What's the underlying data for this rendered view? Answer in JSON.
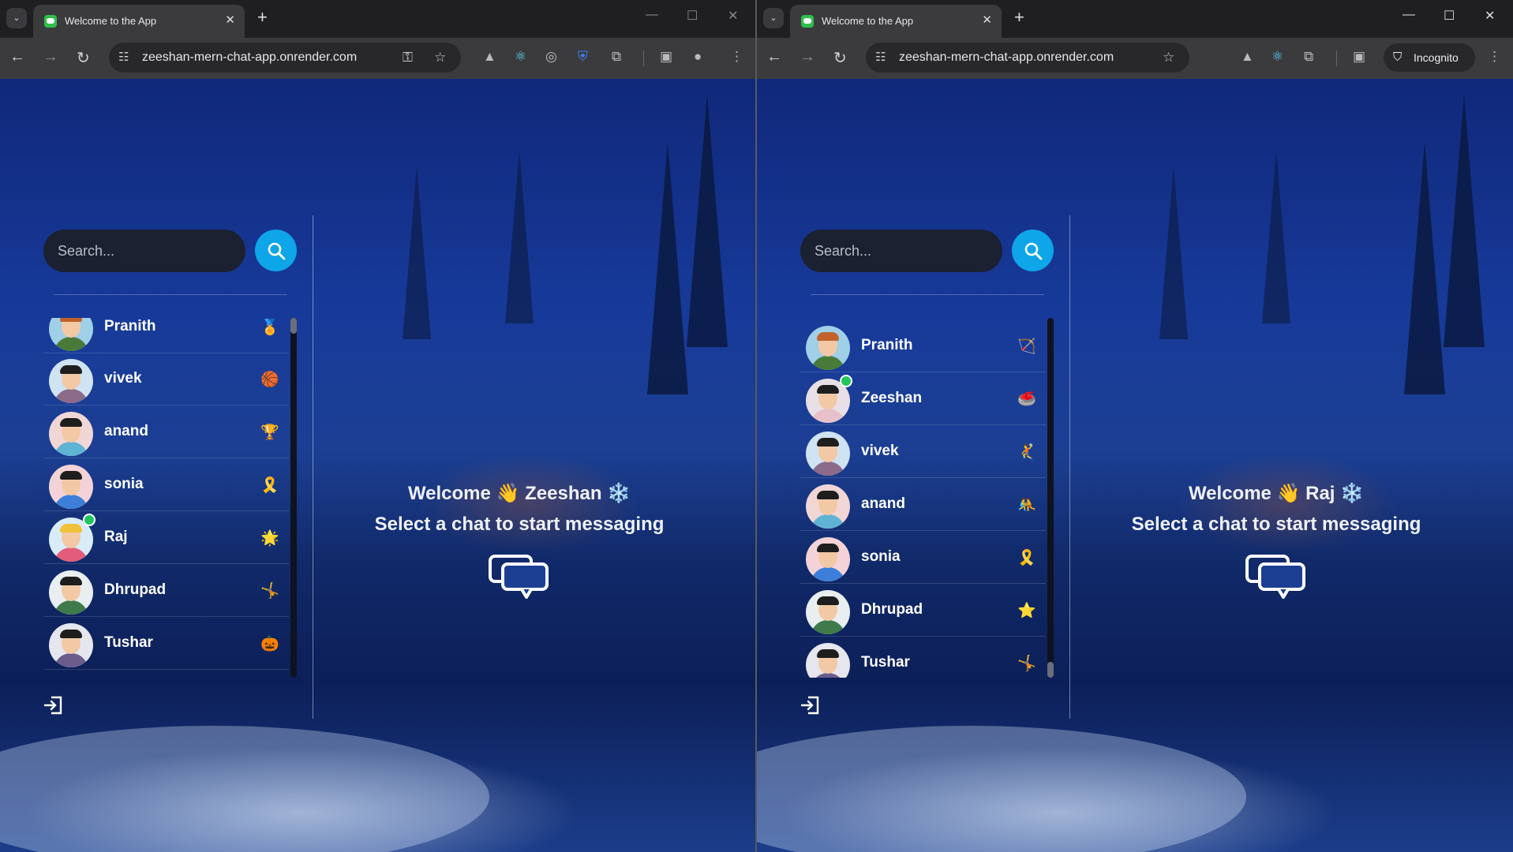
{
  "left_window": {
    "tab_title": "Welcome to the App",
    "url": "zeeshan-mern-chat-app.onrender.com",
    "search_placeholder": "Search...",
    "users": [
      {
        "name": "Pranith",
        "emoji": "🏅",
        "online": false
      },
      {
        "name": "vivek",
        "emoji": "🏀",
        "online": false
      },
      {
        "name": "anand",
        "emoji": "🏆",
        "online": false
      },
      {
        "name": "sonia",
        "emoji": "🎗️",
        "online": false
      },
      {
        "name": "Raj",
        "emoji": "🌟",
        "online": true
      },
      {
        "name": "Dhrupad",
        "emoji": "🤸",
        "online": false
      },
      {
        "name": "Tushar",
        "emoji": "🎃",
        "online": false
      }
    ],
    "welcome_word": "Welcome",
    "wave": "👋",
    "current_user": "Zeeshan",
    "snowflake": "❄️",
    "select_text": "Select a chat to start messaging"
  },
  "right_window": {
    "tab_title": "Welcome to the App",
    "url": "zeeshan-mern-chat-app.onrender.com",
    "incognito_label": "Incognito",
    "search_placeholder": "Search...",
    "users": [
      {
        "name": "Pranith",
        "emoji": "🏹",
        "online": false
      },
      {
        "name": "Zeeshan",
        "emoji": "🥌",
        "online": true
      },
      {
        "name": "vivek",
        "emoji": "🤾",
        "online": false
      },
      {
        "name": "anand",
        "emoji": "🤼",
        "online": false
      },
      {
        "name": "sonia",
        "emoji": "🎗️",
        "online": false
      },
      {
        "name": "Dhrupad",
        "emoji": "⭐",
        "online": false
      },
      {
        "name": "Tushar",
        "emoji": "🤸",
        "online": false
      }
    ],
    "welcome_word": "Welcome",
    "wave": "👋",
    "current_user": "Raj",
    "snowflake": "❄️",
    "select_text": "Select a chat to start messaging"
  },
  "colors": {
    "search_button": "#0ea5e9",
    "online_dot": "#22c55e",
    "tab_bg": "#3b3b3e",
    "toolbar_bg": "#3b3b3e",
    "page_blue": "#173a9a"
  },
  "icons": [
    "search-icon",
    "logout-icon",
    "chat-bubbles-icon",
    "back-icon",
    "forward-icon",
    "reload-icon",
    "star-icon",
    "extensions-icon",
    "incognito-icon",
    "menu-icon"
  ]
}
